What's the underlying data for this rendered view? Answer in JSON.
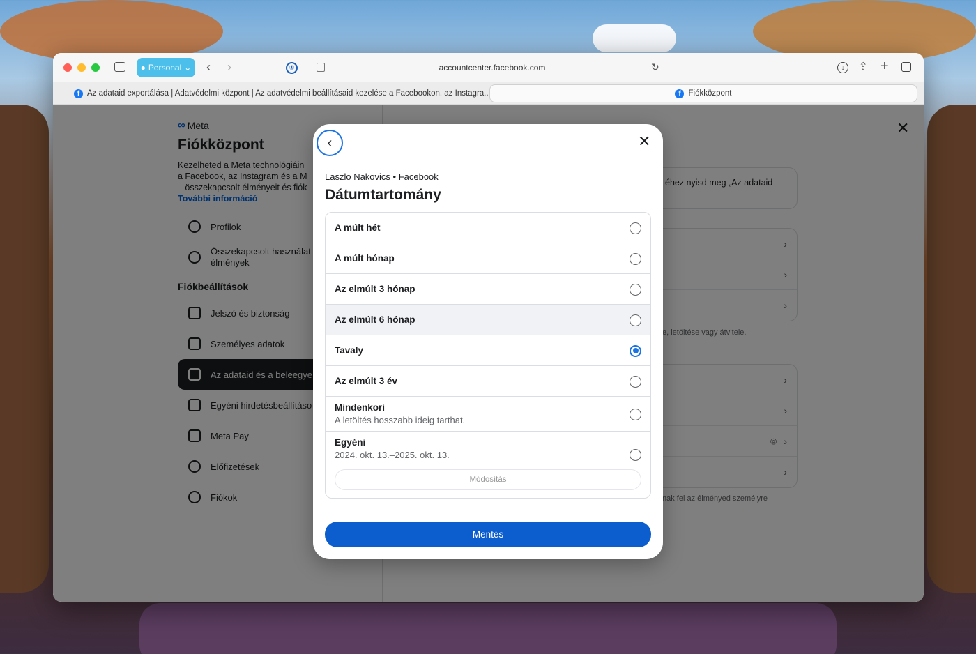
{
  "browser": {
    "profile_label": "Personal",
    "url": "accountcenter.facebook.com",
    "tabs": [
      {
        "title": "Az adataid exportálása | Adatvédelmi központ | Az adatvédelmi beállításaid kezelése a Facebookon, az Instagra..."
      },
      {
        "title": "Fiókközpont"
      }
    ]
  },
  "sidebar": {
    "brand": "Meta",
    "title": "Fiókközpont",
    "description_lines": [
      "Kezelheted a Meta technológiáin",
      "a Facebook, az Instagram és a M",
      "– összekapcsolt élményeit és fiók"
    ],
    "more_link": "További információ",
    "items_top": [
      {
        "label": "Profilok"
      },
      {
        "label": "Összekapcsolt használat",
        "label2": "élmények"
      }
    ],
    "section_heading": "Fiókbeállítások",
    "items": [
      {
        "label": "Jelszó és biztonság"
      },
      {
        "label": "Személyes adatok"
      },
      {
        "label": "Az adataid és a beleegye"
      },
      {
        "label": "Egyéni hirdetésbeállításo"
      },
      {
        "label": "Meta Pay"
      },
      {
        "label": "Előfizetések"
      },
      {
        "label": "Fiókok"
      }
    ]
  },
  "main": {
    "info_text": "éhez nyisd meg „Az adataid",
    "note_1": "e, letöltése vagy átvitele.",
    "note_2": "nak fel az élményed személyre"
  },
  "modal": {
    "account": "Laszlo Nakovics • Facebook",
    "title": "Dátumtartomány",
    "options": [
      {
        "label": "A múlt hét",
        "checked": false
      },
      {
        "label": "A múlt hónap",
        "checked": false
      },
      {
        "label": "Az elmúlt 3 hónap",
        "checked": false
      },
      {
        "label": "Az elmúlt 6 hónap",
        "checked": false
      },
      {
        "label": "Tavaly",
        "checked": true
      },
      {
        "label": "Az elmúlt 3 év",
        "checked": false
      },
      {
        "label": "Mindenkori",
        "sub": "A letöltés hosszabb ideig tarthat.",
        "checked": false
      },
      {
        "label": "Egyéni",
        "sub": "2024. okt. 13.–2025. okt. 13.",
        "checked": false
      }
    ],
    "modify_label": "Módosítás",
    "save_label": "Mentés"
  },
  "colors": {
    "accent": "#1b74e4",
    "save_button": "#0c5ecf",
    "profile_pill": "#4cc0ea"
  }
}
